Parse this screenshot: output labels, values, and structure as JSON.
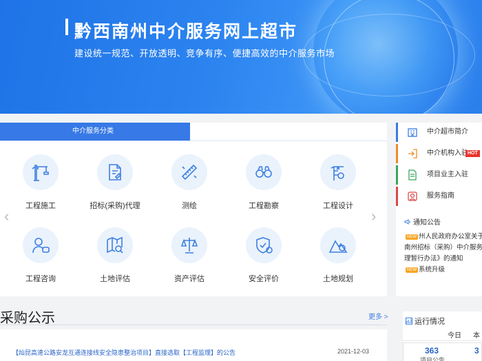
{
  "banner": {
    "title": "黔西南州中介服务网上超市",
    "slogan": "建设统一规范、开放透明、竞争有序、便捷高效的中介服务市场"
  },
  "category": {
    "header": "中介服务分类",
    "services": [
      {
        "label": "工程施工",
        "icon": "crane-icon"
      },
      {
        "label": "招标(采购)代理",
        "icon": "bid-document-icon"
      },
      {
        "label": "测绘",
        "icon": "survey-ruler-icon"
      },
      {
        "label": "工程勘察",
        "icon": "binoculars-icon"
      },
      {
        "label": "工程设计",
        "icon": "design-tower-icon"
      },
      {
        "label": "工程咨询",
        "icon": "consultant-icon"
      },
      {
        "label": "土地评估",
        "icon": "map-search-icon"
      },
      {
        "label": "资产评估",
        "icon": "scale-icon"
      },
      {
        "label": "安全评价",
        "icon": "shield-check-icon"
      },
      {
        "label": "土地规划",
        "icon": "mountain-plan-icon"
      }
    ]
  },
  "quick_links": [
    {
      "label": "中介超市简介",
      "icon": "building-icon",
      "color": "#3b7be0"
    },
    {
      "label": "中介机构入驻",
      "icon": "enter-icon",
      "color": "#f08a24",
      "badge": "HOT"
    },
    {
      "label": "项目业主入驻",
      "icon": "document-icon",
      "color": "#3aa55b"
    },
    {
      "label": "服务指南",
      "icon": "guide-icon",
      "color": "#d94a4a"
    }
  ],
  "notice": {
    "header": "通知公告",
    "lines": [
      "州人民政府办公室关于印",
      "南州招标（采购）中介服务网",
      "理暂行办法》的通知"
    ],
    "second": "系统升级",
    "new_badge": "NEW"
  },
  "procurement": {
    "title": "采购公示",
    "more": "更多 >",
    "items": [
      {
        "title": "【灿昆高速公路安龙互通连接线安全隐患整治项目】直接选取【工程监理】的公告",
        "date": "2021-12-03"
      }
    ]
  },
  "operations": {
    "header": "运行情况",
    "col_today": "今日",
    "col_month": "本",
    "value": "363",
    "value_label": "项目公告",
    "value2": "3"
  }
}
